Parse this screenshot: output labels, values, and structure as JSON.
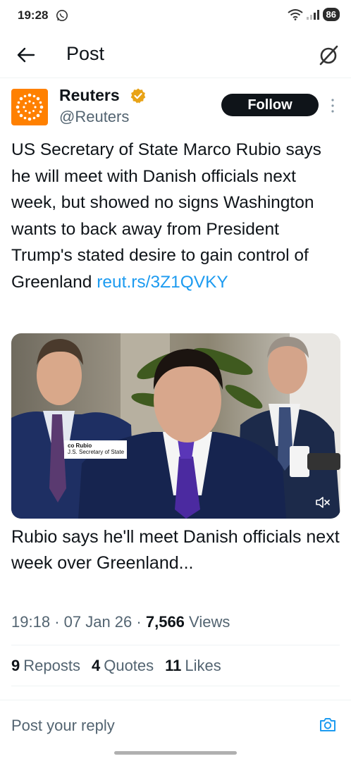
{
  "status_bar": {
    "time": "19:28",
    "battery": "86"
  },
  "header": {
    "title": "Post"
  },
  "author": {
    "name": "Reuters",
    "handle": "@Reuters",
    "follow_label": "Follow"
  },
  "post": {
    "text": "US Secretary of State Marco Rubio says he will meet with Danish officials next week, but showed no signs Washington wants to back away from President Trump's stated desire to gain control of Greenland",
    "link": "reut.rs/3Z1QVKY"
  },
  "media": {
    "lower_third_name": "co Rubio",
    "lower_third_title": "J.S. Secretary of State"
  },
  "card": {
    "title": "Rubio says he'll meet Danish officials next week over Greenland..."
  },
  "meta": {
    "time": "19:18",
    "date": "07 Jan 26",
    "views_count": "7,566",
    "views_label": "Views"
  },
  "stats": {
    "reposts_count": "9",
    "reposts_label": "Reposts",
    "quotes_count": "4",
    "quotes_label": "Quotes",
    "likes_count": "11",
    "likes_label": "Likes"
  },
  "reply": {
    "placeholder": "Post your reply"
  },
  "colors": {
    "accent": "#1d9bf0",
    "text": "#0f1419",
    "muted": "#536471",
    "brand": "#ff8000",
    "verified": "#e8a317"
  }
}
